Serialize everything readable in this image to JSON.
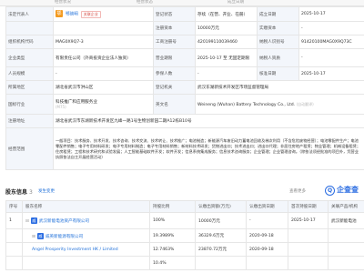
{
  "header": {
    "col1": "",
    "col2": "经营状况",
    "col3": "经营状态",
    "col4": "成立日期"
  },
  "info": {
    "legal_rep_label": "法定代表人",
    "legal_rep_avatar": "鄂",
    "legal_rep_name": "鄂晓明",
    "legal_rep_tag": "关联企业",
    "status_label": "登记状态",
    "status_value": "存续（在营、开业、在册）",
    "established_label": "成立日期",
    "established_value": "2025-10-17",
    "reg_capital_label": "注册资本",
    "reg_capital_value": "10000万元",
    "paid_capital_label": "实缴资本",
    "paid_capital_value": "-",
    "org_code_label": "组织机构代码",
    "org_code_value": "MAG0X9Q7-3",
    "biz_reg_label": "工商注册号",
    "biz_reg_value": "420199110039460",
    "taxpayer_label": "纳税人识别号",
    "taxpayer_value": "91420100MAG0X9Q73C",
    "company_type_label": "企业类型",
    "company_type_value": "有限责任公司（外商投资企业法人独资）",
    "biz_term_label": "营业期限",
    "biz_term_value": "2025-10-17 至 无固定期限",
    "taxpayer_qual_label": "纳税人资质",
    "taxpayer_qual_value": "-",
    "staff_label": "人员规模",
    "staff_value": "-",
    "insured_label": "参保人数",
    "insured_value": "-",
    "approval_label": "核准日期",
    "approval_value": "2025-10-17",
    "region_label": "所属地区",
    "region_value": "湖北省武汉市洪山区",
    "authority_label": "登记机关",
    "authority_value": "武汉东湖新技术开发区市场监督管理局",
    "industry_label": "国标行业",
    "industry_value": "科技推广和应用服务业",
    "industry_code": "(M75)",
    "en_name_label": "英文名",
    "en_name_value": "Weineng (Wuhan) Battery Technology Co., Ltd.",
    "en_name_note": "(自动翻译)",
    "address_label": "注册地址",
    "address_value": "湖北省武汉市东湖新技术开发区九峰一路1号生物创新园二期A12栋B10号",
    "scope_label": "经营范围",
    "scope_value": "一般项目：技术服务、技术开发、技术咨询、技术交流、技术转让、技术推广；电池制造；新能源汽车废旧动力蓄电池回收及梯次利用（不含危险废物经营）；电池零配件生产；电池零配件销售；电子专用材料研发；电子专用材料制造；电子专用材料销售；新材料技术研发；货物进出口；技术进出口；进出口代理；非居住房地产租赁；物业管理；机械设备租赁；住房租赁；工程和技术研究和试验发展；人工智能基础软件开发；软件开发；信息系统集成服务；信息技术咨询服务；企业管理；企业管理咨询。（除依法须经批准的项目外，凭营业执照依法自主开展经营活动）"
  },
  "shareholders": {
    "title": "股东信息",
    "count": "3",
    "note": "发生变更",
    "actions": "查看更多",
    "brand": "企查查",
    "brand_mark": "Q",
    "columns": [
      "序号",
      "股东名称",
      "持股比例",
      "认缴出资额(万元)",
      "认缴出资日期",
      "首次持股日期",
      "关联产品/机构"
    ],
    "rows": [
      {
        "no": "1",
        "icon": "威",
        "name": "武汉新能电池资产有限公司",
        "ratio": "100%",
        "amount": "10000万元",
        "date": "-",
        "first": "2025-10-17",
        "product": "武汉新能电池"
      },
      {
        "no": "",
        "icon": "威",
        "name": "威英新能源有限公司",
        "ratio": "19.3989%",
        "amount": "36329.6万元",
        "date": "2020-09-18",
        "first": "",
        "product": ""
      },
      {
        "no": "",
        "icon": "",
        "name": "Angel Prosperity Investment HK / Limited",
        "ratio": "12.7463%",
        "amount": "23870.72万元",
        "date": "2020-09-18",
        "first": "",
        "product": ""
      },
      {
        "no": "",
        "icon": "",
        "name": "",
        "ratio": "10.4%",
        "amount": "",
        "date": "",
        "first": "",
        "product": ""
      }
    ]
  }
}
